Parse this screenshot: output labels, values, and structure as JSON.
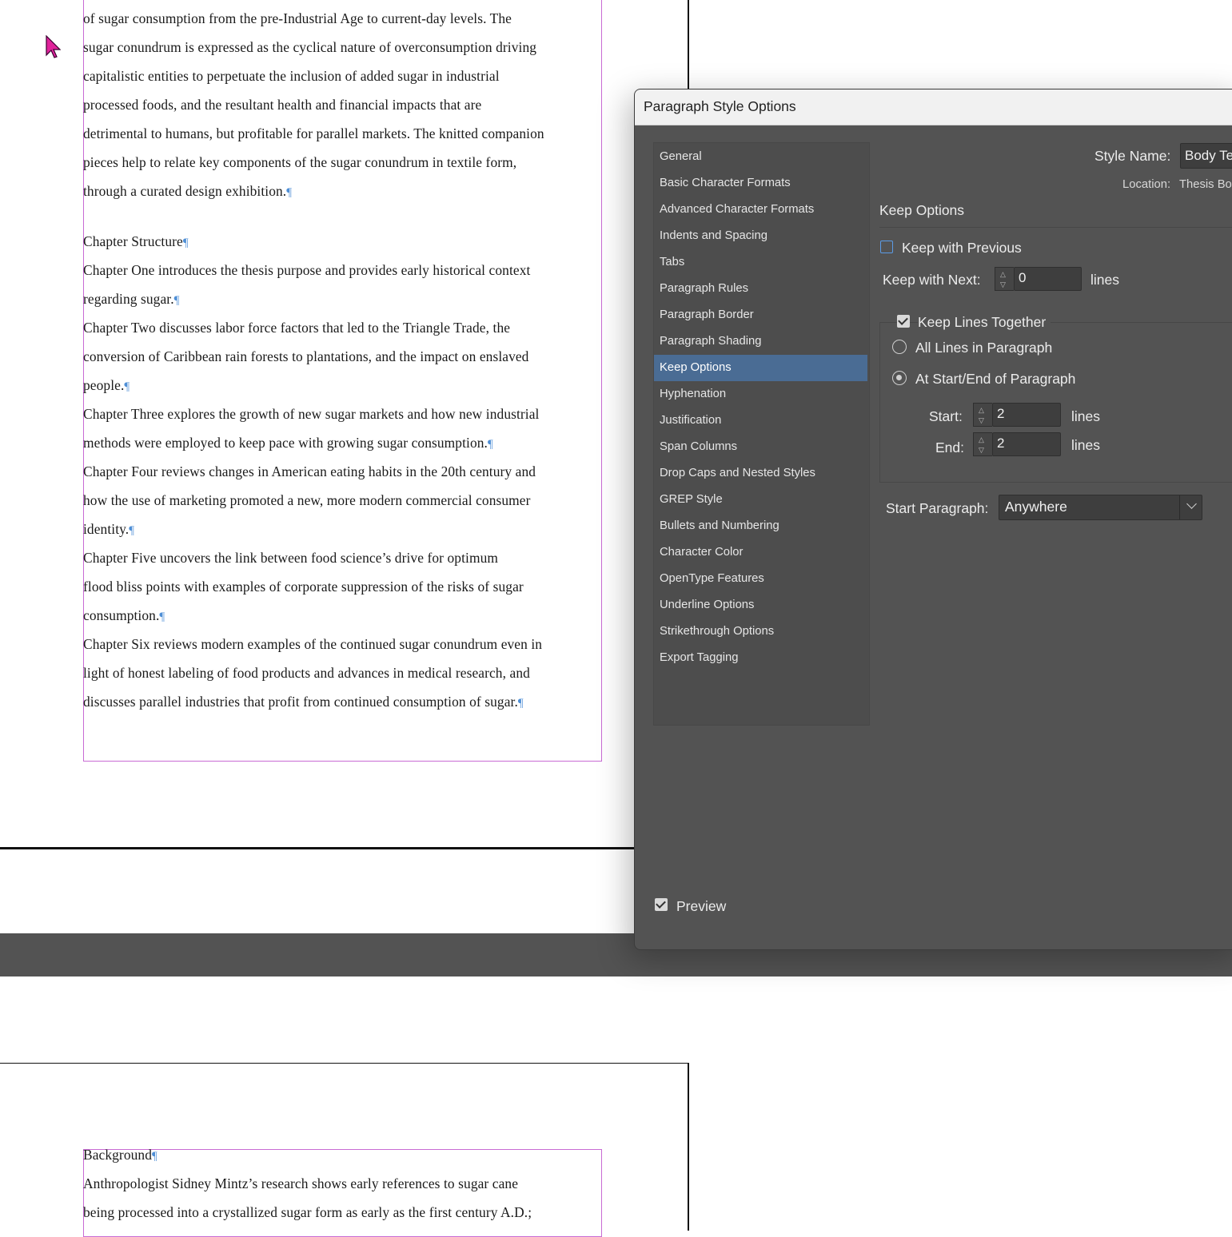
{
  "document": {
    "upper_paragraphs": [
      "of sugar consumption from the pre-Industrial Age to current-day levels. The",
      "sugar conundrum is expressed as the cyclical nature of overconsumption driving",
      "capitalistic entities to perpetuate the inclusion of added sugar in industrial",
      "processed foods, and the resultant health and financial impacts that are",
      "detrimental to humans, but profitable for parallel markets. The knitted companion",
      "pieces help to relate key components of the sugar conundrum in textile form,",
      "through a curated design exhibition.",
      "Chapter Structure",
      "Chapter One introduces the thesis purpose and provides early historical context",
      "regarding sugar.",
      "Chapter Two discusses labor force factors that led to the Triangle Trade, the",
      "conversion of Caribbean rain forests to plantations, and the impact on enslaved",
      "people.",
      "Chapter Three explores the growth of new sugar markets and how new industrial",
      "methods were employed to keep pace with growing sugar consumption.",
      "Chapter Four reviews changes in American eating habits in the 20th century and",
      "how the use of marketing promoted a new, more modern commercial consumer",
      "identity.",
      "Chapter Five uncovers the link between food science’s drive for optimum",
      "flood bliss points with examples of corporate suppression of the risks of sugar",
      "consumption.",
      "Chapter Six reviews modern examples of the continued sugar conundrum even in",
      "light of honest labeling of food products and advances in medical research, and",
      "discusses parallel industries that profit from continued consumption of sugar."
    ],
    "lower_paragraphs": [
      "Background",
      "Anthropologist Sidney Mintz’s research shows early references to sugar cane",
      "being processed into a crystallized sugar form as early as the first century A.D.;"
    ],
    "pilcrow": "¶"
  },
  "dialog": {
    "title": "Paragraph Style Options",
    "categories": [
      "General",
      "Basic Character Formats",
      "Advanced Character Formats",
      "Indents and Spacing",
      "Tabs",
      "Paragraph Rules",
      "Paragraph Border",
      "Paragraph Shading",
      "Keep Options",
      "Hyphenation",
      "Justification",
      "Span Columns",
      "Drop Caps and Nested Styles",
      "GREP Style",
      "Bullets and Numbering",
      "Character Color",
      "OpenType Features",
      "Underline Options",
      "Strikethrough Options",
      "Export Tagging"
    ],
    "active_category": "Keep Options",
    "style_name_label": "Style Name:",
    "style_name_value": "Body Te",
    "location_label": "Location:",
    "location_value": "Thesis Bo",
    "section_title": "Keep Options",
    "keep_with_previous": {
      "label": "Keep with Previous",
      "checked": false
    },
    "keep_with_next": {
      "label": "Keep with Next:",
      "value": "0",
      "unit": "lines"
    },
    "keep_lines_together": {
      "label": "Keep Lines Together",
      "checked": true
    },
    "all_lines": {
      "label": "All Lines in Paragraph",
      "selected": false
    },
    "at_start_end": {
      "label": "At Start/End of Paragraph",
      "selected": true
    },
    "start": {
      "label": "Start:",
      "value": "2",
      "unit": "lines"
    },
    "end": {
      "label": "End:",
      "value": "2",
      "unit": "lines"
    },
    "start_paragraph": {
      "label": "Start Paragraph:",
      "value": "Anywhere"
    },
    "preview": {
      "label": "Preview",
      "checked": true
    }
  }
}
